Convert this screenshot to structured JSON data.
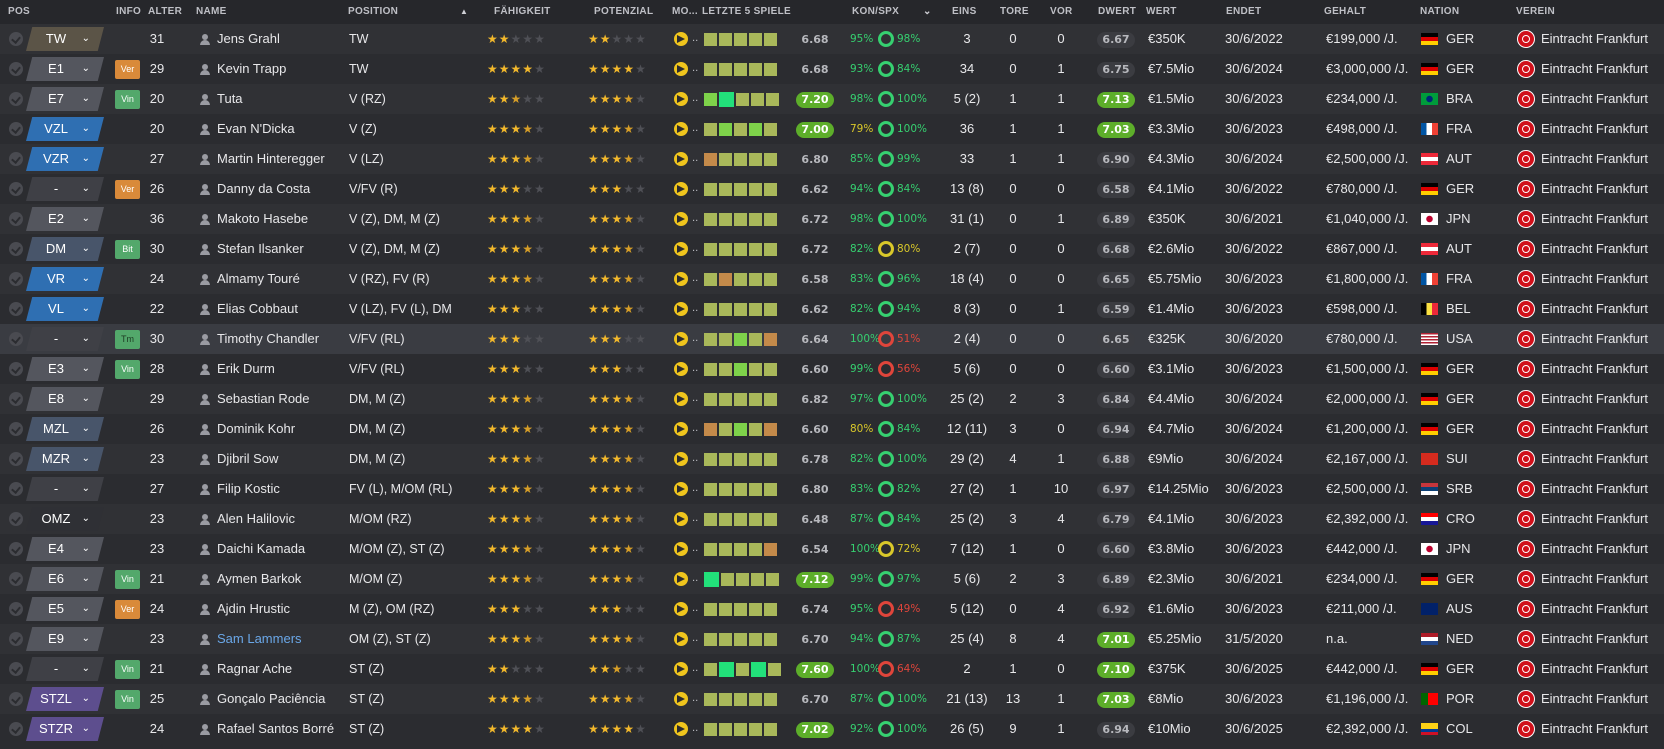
{
  "columns": {
    "pos": "POS",
    "info": "INFO",
    "alter": "ALTER",
    "name": "NAME",
    "position": "POSITION",
    "faehigkeit": "FÄHIGKEIT",
    "potenzial": "POTENZIAL",
    "moral": "MO...",
    "form": "LETZTE 5 SPIELE",
    "konspx": "KON/SPX",
    "eins": "EINS",
    "tore": "TORE",
    "vor": "VOR",
    "dwert": "DWERT",
    "wert": "WERT",
    "endet": "ENDET",
    "gehalt": "GEHALT",
    "nation": "NATION",
    "verein": "VEREIN",
    "sort_icon": "sort-ascending-icon",
    "kon_dropdown_icon": "chevron-down-icon"
  },
  "colors": {
    "star_full": "#f2b82c",
    "star_empty": "#4f5056",
    "rating_good": "#5dae2a",
    "form_high": "#22e07a",
    "form_good": "#7ed24a",
    "form_mid": "#a9b85a",
    "form_low": "#c48a4a",
    "kon_green": "#36d070",
    "kon_yellow": "#d9c82a",
    "kon_red": "#e0453b"
  },
  "rows": [
    {
      "pos": "TW",
      "pos_style": "gk",
      "info": "",
      "alter": "31",
      "name": "Jens Grahl",
      "position": "TW",
      "ability": 2,
      "potential": 2,
      "form": [
        "mid",
        "mid",
        "mid",
        "mid",
        "mid"
      ],
      "avg": "6.68",
      "avg_good": false,
      "kon": "95%",
      "kon_c": "green",
      "spx": "98%",
      "spx_c": "green",
      "eins": "3",
      "tore": "0",
      "vor": "0",
      "dwert": "6.67",
      "dwert_good": false,
      "wert": "€350K",
      "endet": "30/6/2022",
      "gehalt": "€199,000 /J.",
      "nation": "GER",
      "flag": "ger",
      "verein": "Eintracht Frankfurt",
      "link": false
    },
    {
      "pos": "E1",
      "pos_style": "sub",
      "info": "Ver",
      "info_style": "ver",
      "alter": "29",
      "name": "Kevin Trapp",
      "position": "TW",
      "ability": 4,
      "potential": 4,
      "form": [
        "mid",
        "mid",
        "mid",
        "mid",
        "mid"
      ],
      "avg": "6.68",
      "avg_good": false,
      "kon": "93%",
      "kon_c": "green",
      "spx": "84%",
      "spx_c": "green",
      "eins": "34",
      "tore": "0",
      "vor": "1",
      "dwert": "6.75",
      "dwert_good": false,
      "wert": "€7.5Mio",
      "endet": "30/6/2024",
      "gehalt": "€3,000,000 /J.",
      "nation": "GER",
      "flag": "ger",
      "verein": "Eintracht Frankfurt",
      "link": false
    },
    {
      "pos": "E7",
      "pos_style": "sub",
      "info": "Vin",
      "info_style": "vin",
      "alter": "20",
      "name": "Tuta",
      "position": "V (RZ)",
      "ability": 2.5,
      "potential": 3.5,
      "form": [
        "good",
        "high",
        "mid",
        "mid",
        "mid"
      ],
      "avg": "7.20",
      "avg_good": true,
      "kon": "98%",
      "kon_c": "green",
      "spx": "100%",
      "spx_c": "green",
      "eins": "5 (2)",
      "tore": "1",
      "vor": "1",
      "dwert": "7.13",
      "dwert_good": true,
      "wert": "€1.5Mio",
      "endet": "30/6/2023",
      "gehalt": "€234,000 /J.",
      "nation": "BRA",
      "flag": "bra",
      "verein": "Eintracht Frankfurt",
      "link": false
    },
    {
      "pos": "VZL",
      "pos_style": "def",
      "info": "",
      "alter": "20",
      "name": "Evan N'Dicka",
      "position": "V (Z)",
      "ability": 3.5,
      "potential": 3.5,
      "form": [
        "mid",
        "good",
        "mid",
        "good",
        "mid"
      ],
      "avg": "7.00",
      "avg_good": true,
      "kon": "79%",
      "kon_c": "yellow",
      "spx": "100%",
      "spx_c": "green",
      "eins": "36",
      "tore": "1",
      "vor": "1",
      "dwert": "7.03",
      "dwert_good": true,
      "wert": "€3.3Mio",
      "endet": "30/6/2023",
      "gehalt": "€498,000 /J.",
      "nation": "FRA",
      "flag": "fra",
      "verein": "Eintracht Frankfurt",
      "link": false
    },
    {
      "pos": "VZR",
      "pos_style": "def",
      "info": "",
      "alter": "27",
      "name": "Martin Hinteregger",
      "position": "V (LZ)",
      "ability": 3.5,
      "potential": 3.5,
      "form": [
        "low",
        "mid",
        "mid",
        "mid",
        "mid"
      ],
      "avg": "6.80",
      "avg_good": false,
      "kon": "85%",
      "kon_c": "green",
      "spx": "99%",
      "spx_c": "green",
      "eins": "33",
      "tore": "1",
      "vor": "1",
      "dwert": "6.90",
      "dwert_good": false,
      "wert": "€4.3Mio",
      "endet": "30/6/2024",
      "gehalt": "€2,500,000 /J.",
      "nation": "AUT",
      "flag": "aut",
      "verein": "Eintracht Frankfurt",
      "link": false
    },
    {
      "pos": "-",
      "pos_style": "none",
      "info": "Ver",
      "info_style": "ver",
      "alter": "26",
      "name": "Danny da Costa",
      "position": "V/FV (R)",
      "ability": 3,
      "potential": 3,
      "form": [
        "mid",
        "mid",
        "mid",
        "mid",
        "mid"
      ],
      "avg": "6.62",
      "avg_good": false,
      "kon": "94%",
      "kon_c": "green",
      "spx": "84%",
      "spx_c": "green",
      "eins": "13 (8)",
      "tore": "0",
      "vor": "0",
      "dwert": "6.58",
      "dwert_good": false,
      "wert": "€4.1Mio",
      "endet": "30/6/2022",
      "gehalt": "€780,000 /J.",
      "nation": "GER",
      "flag": "ger",
      "verein": "Eintracht Frankfurt",
      "link": false
    },
    {
      "pos": "E2",
      "pos_style": "sub",
      "info": "",
      "alter": "36",
      "name": "Makoto Hasebe",
      "position": "V (Z), DM, M (Z)",
      "ability": 3.5,
      "potential": 3.5,
      "form": [
        "mid",
        "mid",
        "mid",
        "mid",
        "mid"
      ],
      "avg": "6.72",
      "avg_good": false,
      "kon": "98%",
      "kon_c": "green",
      "spx": "100%",
      "spx_c": "green",
      "eins": "31 (1)",
      "tore": "0",
      "vor": "1",
      "dwert": "6.89",
      "dwert_good": false,
      "wert": "€350K",
      "endet": "30/6/2021",
      "gehalt": "€1,040,000 /J.",
      "nation": "JPN",
      "flag": "jpn",
      "verein": "Eintracht Frankfurt",
      "link": false
    },
    {
      "pos": "DM",
      "pos_style": "mid",
      "info": "Bit",
      "info_style": "bit",
      "alter": "30",
      "name": "Stefan Ilsanker",
      "position": "V (Z), DM, M (Z)",
      "ability": 3.5,
      "potential": 3.5,
      "form": [
        "mid",
        "mid",
        "mid",
        "mid",
        "mid"
      ],
      "avg": "6.72",
      "avg_good": false,
      "kon": "82%",
      "kon_c": "green",
      "spx": "80%",
      "spx_c": "yellow",
      "eins": "2 (7)",
      "tore": "0",
      "vor": "0",
      "dwert": "6.68",
      "dwert_good": false,
      "wert": "€2.6Mio",
      "endet": "30/6/2022",
      "gehalt": "€867,000 /J.",
      "nation": "AUT",
      "flag": "aut",
      "verein": "Eintracht Frankfurt",
      "link": false
    },
    {
      "pos": "VR",
      "pos_style": "def",
      "info": "",
      "alter": "24",
      "name": "Almamy Touré",
      "position": "V (RZ), FV (R)",
      "ability": 3.5,
      "potential": 3.5,
      "form": [
        "mid",
        "low",
        "mid",
        "mid",
        "mid"
      ],
      "avg": "6.58",
      "avg_good": false,
      "kon": "83%",
      "kon_c": "green",
      "spx": "96%",
      "spx_c": "green",
      "eins": "18 (4)",
      "tore": "0",
      "vor": "0",
      "dwert": "6.65",
      "dwert_good": false,
      "wert": "€5.75Mio",
      "endet": "30/6/2023",
      "gehalt": "€1,800,000 /J.",
      "nation": "FRA",
      "flag": "fra",
      "verein": "Eintracht Frankfurt",
      "link": false
    },
    {
      "pos": "VL",
      "pos_style": "def",
      "info": "",
      "alter": "22",
      "name": "Elias Cobbaut",
      "position": "V (LZ), FV (L), DM",
      "ability": 3,
      "potential": 3.5,
      "form": [
        "mid",
        "mid",
        "mid",
        "mid",
        "mid"
      ],
      "avg": "6.62",
      "avg_good": false,
      "kon": "82%",
      "kon_c": "green",
      "spx": "94%",
      "spx_c": "green",
      "eins": "8 (3)",
      "tore": "0",
      "vor": "1",
      "dwert": "6.59",
      "dwert_good": false,
      "wert": "€1.4Mio",
      "endet": "30/6/2023",
      "gehalt": "€598,000 /J.",
      "nation": "BEL",
      "flag": "bel",
      "verein": "Eintracht Frankfurt",
      "link": false
    },
    {
      "pos": "-",
      "pos_style": "none",
      "info": "Tm",
      "info_style": "tm",
      "alter": "30",
      "name": "Timothy Chandler",
      "position": "V/FV (RL)",
      "ability": 3,
      "potential": 3,
      "form": [
        "mid",
        "mid",
        "good",
        "mid",
        "low"
      ],
      "avg": "6.64",
      "avg_good": false,
      "kon": "100%",
      "kon_c": "green",
      "spx": "51%",
      "spx_c": "red",
      "eins": "2 (4)",
      "tore": "0",
      "vor": "0",
      "dwert": "6.65",
      "dwert_good": false,
      "wert": "€325K",
      "endet": "30/6/2020",
      "gehalt": "€780,000 /J.",
      "nation": "USA",
      "flag": "usa",
      "verein": "Eintracht Frankfurt",
      "link": false
    },
    {
      "pos": "E3",
      "pos_style": "sub",
      "info": "Vin",
      "info_style": "vin",
      "alter": "28",
      "name": "Erik Durm",
      "position": "V/FV (RL)",
      "ability": 3,
      "potential": 3,
      "form": [
        "mid",
        "mid",
        "good",
        "mid",
        "mid"
      ],
      "avg": "6.60",
      "avg_good": false,
      "kon": "99%",
      "kon_c": "green",
      "spx": "56%",
      "spx_c": "red",
      "eins": "5 (6)",
      "tore": "0",
      "vor": "0",
      "dwert": "6.60",
      "dwert_good": false,
      "wert": "€3.1Mio",
      "endet": "30/6/2023",
      "gehalt": "€1,500,000 /J.",
      "nation": "GER",
      "flag": "ger",
      "verein": "Eintracht Frankfurt",
      "link": false
    },
    {
      "pos": "E8",
      "pos_style": "sub",
      "info": "",
      "alter": "29",
      "name": "Sebastian Rode",
      "position": "DM, M (Z)",
      "ability": 3.5,
      "potential": 3.5,
      "form": [
        "mid",
        "mid",
        "mid",
        "mid",
        "mid"
      ],
      "avg": "6.82",
      "avg_good": false,
      "kon": "97%",
      "kon_c": "green",
      "spx": "100%",
      "spx_c": "green",
      "eins": "25 (2)",
      "tore": "2",
      "vor": "3",
      "dwert": "6.84",
      "dwert_good": false,
      "wert": "€4.4Mio",
      "endet": "30/6/2024",
      "gehalt": "€2,000,000 /J.",
      "nation": "GER",
      "flag": "ger",
      "verein": "Eintracht Frankfurt",
      "link": false
    },
    {
      "pos": "MZL",
      "pos_style": "mid",
      "info": "",
      "alter": "26",
      "name": "Dominik Kohr",
      "position": "DM, M (Z)",
      "ability": 3.5,
      "potential": 3.5,
      "form": [
        "low",
        "mid",
        "good",
        "mid",
        "low"
      ],
      "avg": "6.60",
      "avg_good": false,
      "kon": "80%",
      "kon_c": "yellow",
      "spx": "84%",
      "spx_c": "green",
      "eins": "12 (11)",
      "tore": "3",
      "vor": "0",
      "dwert": "6.94",
      "dwert_good": false,
      "wert": "€4.7Mio",
      "endet": "30/6/2024",
      "gehalt": "€1,200,000 /J.",
      "nation": "GER",
      "flag": "ger",
      "verein": "Eintracht Frankfurt",
      "link": false
    },
    {
      "pos": "MZR",
      "pos_style": "mid",
      "info": "",
      "alter": "23",
      "name": "Djibril Sow",
      "position": "DM, M (Z)",
      "ability": 3.5,
      "potential": 3.5,
      "form": [
        "mid",
        "mid",
        "mid",
        "mid",
        "mid"
      ],
      "avg": "6.78",
      "avg_good": false,
      "kon": "82%",
      "kon_c": "green",
      "spx": "100%",
      "spx_c": "green",
      "eins": "29 (2)",
      "tore": "4",
      "vor": "1",
      "dwert": "6.88",
      "dwert_good": false,
      "wert": "€9Mio",
      "endet": "30/6/2024",
      "gehalt": "€2,167,000 /J.",
      "nation": "SUI",
      "flag": "sui",
      "verein": "Eintracht Frankfurt",
      "link": false
    },
    {
      "pos": "-",
      "pos_style": "none",
      "info": "",
      "alter": "27",
      "name": "Filip Kostic",
      "position": "FV (L), M/OM (RL)",
      "ability": 3.5,
      "potential": 3.5,
      "form": [
        "mid",
        "mid",
        "mid",
        "mid",
        "mid"
      ],
      "avg": "6.80",
      "avg_good": false,
      "kon": "83%",
      "kon_c": "green",
      "spx": "82%",
      "spx_c": "green",
      "eins": "27 (2)",
      "tore": "1",
      "vor": "10",
      "dwert": "6.97",
      "dwert_good": false,
      "wert": "€14.25Mio",
      "endet": "30/6/2023",
      "gehalt": "€2,500,000 /J.",
      "nation": "SRB",
      "flag": "srb",
      "verein": "Eintracht Frankfurt",
      "link": false
    },
    {
      "pos": "OMZ",
      "pos_style": "omz",
      "info": "",
      "alter": "23",
      "name": "Alen Halilovic",
      "position": "M/OM (RZ)",
      "ability": 3.5,
      "potential": 3.5,
      "form": [
        "mid",
        "mid",
        "mid",
        "mid",
        "mid"
      ],
      "avg": "6.48",
      "avg_good": false,
      "kon": "87%",
      "kon_c": "green",
      "spx": "84%",
      "spx_c": "green",
      "eins": "25 (2)",
      "tore": "3",
      "vor": "4",
      "dwert": "6.79",
      "dwert_good": false,
      "wert": "€4.1Mio",
      "endet": "30/6/2023",
      "gehalt": "€2,392,000 /J.",
      "nation": "CRO",
      "flag": "cro",
      "verein": "Eintracht Frankfurt",
      "link": false
    },
    {
      "pos": "E4",
      "pos_style": "sub",
      "info": "",
      "alter": "23",
      "name": "Daichi Kamada",
      "position": "M/OM (Z), ST (Z)",
      "ability": 3.5,
      "potential": 3.5,
      "form": [
        "mid",
        "mid",
        "mid",
        "mid",
        "low"
      ],
      "avg": "6.54",
      "avg_good": false,
      "kon": "100%",
      "kon_c": "green",
      "spx": "72%",
      "spx_c": "yellow",
      "eins": "7 (12)",
      "tore": "1",
      "vor": "0",
      "dwert": "6.60",
      "dwert_good": false,
      "wert": "€3.8Mio",
      "endet": "30/6/2023",
      "gehalt": "€442,000 /J.",
      "nation": "JPN",
      "flag": "jpn",
      "verein": "Eintracht Frankfurt",
      "link": false
    },
    {
      "pos": "E6",
      "pos_style": "sub",
      "info": "Vin",
      "info_style": "vin",
      "alter": "21",
      "name": "Aymen Barkok",
      "position": "M/OM (Z)",
      "ability": 3.5,
      "potential": 3.5,
      "form": [
        "high",
        "mid",
        "mid",
        "mid",
        "mid"
      ],
      "avg": "7.12",
      "avg_good": true,
      "kon": "99%",
      "kon_c": "green",
      "spx": "97%",
      "spx_c": "green",
      "eins": "5 (6)",
      "tore": "2",
      "vor": "3",
      "dwert": "6.89",
      "dwert_good": false,
      "wert": "€2.3Mio",
      "endet": "30/6/2021",
      "gehalt": "€234,000 /J.",
      "nation": "GER",
      "flag": "ger",
      "verein": "Eintracht Frankfurt",
      "link": false
    },
    {
      "pos": "E5",
      "pos_style": "sub",
      "info": "Ver",
      "info_style": "ver",
      "alter": "24",
      "name": "Ajdin Hrustic",
      "position": "M (Z), OM (RZ)",
      "ability": 3,
      "potential": 3,
      "form": [
        "mid",
        "mid",
        "mid",
        "mid",
        "mid"
      ],
      "avg": "6.74",
      "avg_good": false,
      "kon": "95%",
      "kon_c": "green",
      "spx": "49%",
      "spx_c": "red",
      "eins": "5 (12)",
      "tore": "0",
      "vor": "4",
      "dwert": "6.92",
      "dwert_good": false,
      "wert": "€1.6Mio",
      "endet": "30/6/2023",
      "gehalt": "€211,000 /J.",
      "nation": "AUS",
      "flag": "aus",
      "verein": "Eintracht Frankfurt",
      "link": false
    },
    {
      "pos": "E9",
      "pos_style": "sub",
      "info": "",
      "alter": "23",
      "name": "Sam Lammers",
      "position": "OM (Z), ST (Z)",
      "ability": 3.5,
      "potential": 3.5,
      "form": [
        "mid",
        "mid",
        "mid",
        "mid",
        "mid"
      ],
      "avg": "6.70",
      "avg_good": false,
      "kon": "94%",
      "kon_c": "green",
      "spx": "87%",
      "spx_c": "green",
      "eins": "25 (4)",
      "tore": "8",
      "vor": "4",
      "dwert": "7.01",
      "dwert_good": true,
      "wert": "€5.25Mio",
      "endet": "31/5/2020",
      "gehalt": "n.a.",
      "nation": "NED",
      "flag": "ned",
      "verein": "Eintracht Frankfurt",
      "link": true
    },
    {
      "pos": "-",
      "pos_style": "none",
      "info": "Vin",
      "info_style": "vin",
      "alter": "21",
      "name": "Ragnar Ache",
      "position": "ST (Z)",
      "ability": 2,
      "potential": 2.5,
      "form": [
        "mid",
        "high",
        "mid",
        "high",
        "mid"
      ],
      "avg": "7.60",
      "avg_good": true,
      "kon": "100%",
      "kon_c": "green",
      "spx": "64%",
      "spx_c": "red",
      "eins": "2",
      "tore": "1",
      "vor": "0",
      "dwert": "7.10",
      "dwert_good": true,
      "wert": "€375K",
      "endet": "30/6/2025",
      "gehalt": "€442,000 /J.",
      "nation": "GER",
      "flag": "ger",
      "verein": "Eintracht Frankfurt",
      "link": false
    },
    {
      "pos": "STZL",
      "pos_style": "att",
      "info": "Vin",
      "info_style": "vin",
      "alter": "25",
      "name": "Gonçalo Paciência",
      "position": "ST (Z)",
      "ability": 3.5,
      "potential": 3.5,
      "form": [
        "mid",
        "mid",
        "mid",
        "mid",
        "mid"
      ],
      "avg": "6.70",
      "avg_good": false,
      "kon": "87%",
      "kon_c": "green",
      "spx": "100%",
      "spx_c": "green",
      "eins": "21 (13)",
      "tore": "13",
      "vor": "1",
      "dwert": "7.03",
      "dwert_good": true,
      "wert": "€8Mio",
      "endet": "30/6/2023",
      "gehalt": "€1,196,000 /J.",
      "nation": "POR",
      "flag": "por",
      "verein": "Eintracht Frankfurt",
      "link": false
    },
    {
      "pos": "STZR",
      "pos_style": "att",
      "info": "",
      "alter": "24",
      "name": "Rafael Santos Borré",
      "position": "ST (Z)",
      "ability": 4,
      "potential": 4,
      "form": [
        "mid",
        "mid",
        "mid",
        "mid",
        "mid"
      ],
      "avg": "7.02",
      "avg_good": true,
      "kon": "92%",
      "kon_c": "green",
      "spx": "100%",
      "spx_c": "green",
      "eins": "26 (5)",
      "tore": "9",
      "vor": "1",
      "dwert": "6.94",
      "dwert_good": false,
      "wert": "€10Mio",
      "endet": "30/6/2025",
      "gehalt": "€2,392,000 /J.",
      "nation": "COL",
      "flag": "col",
      "verein": "Eintracht Frankfurt",
      "link": false
    }
  ]
}
